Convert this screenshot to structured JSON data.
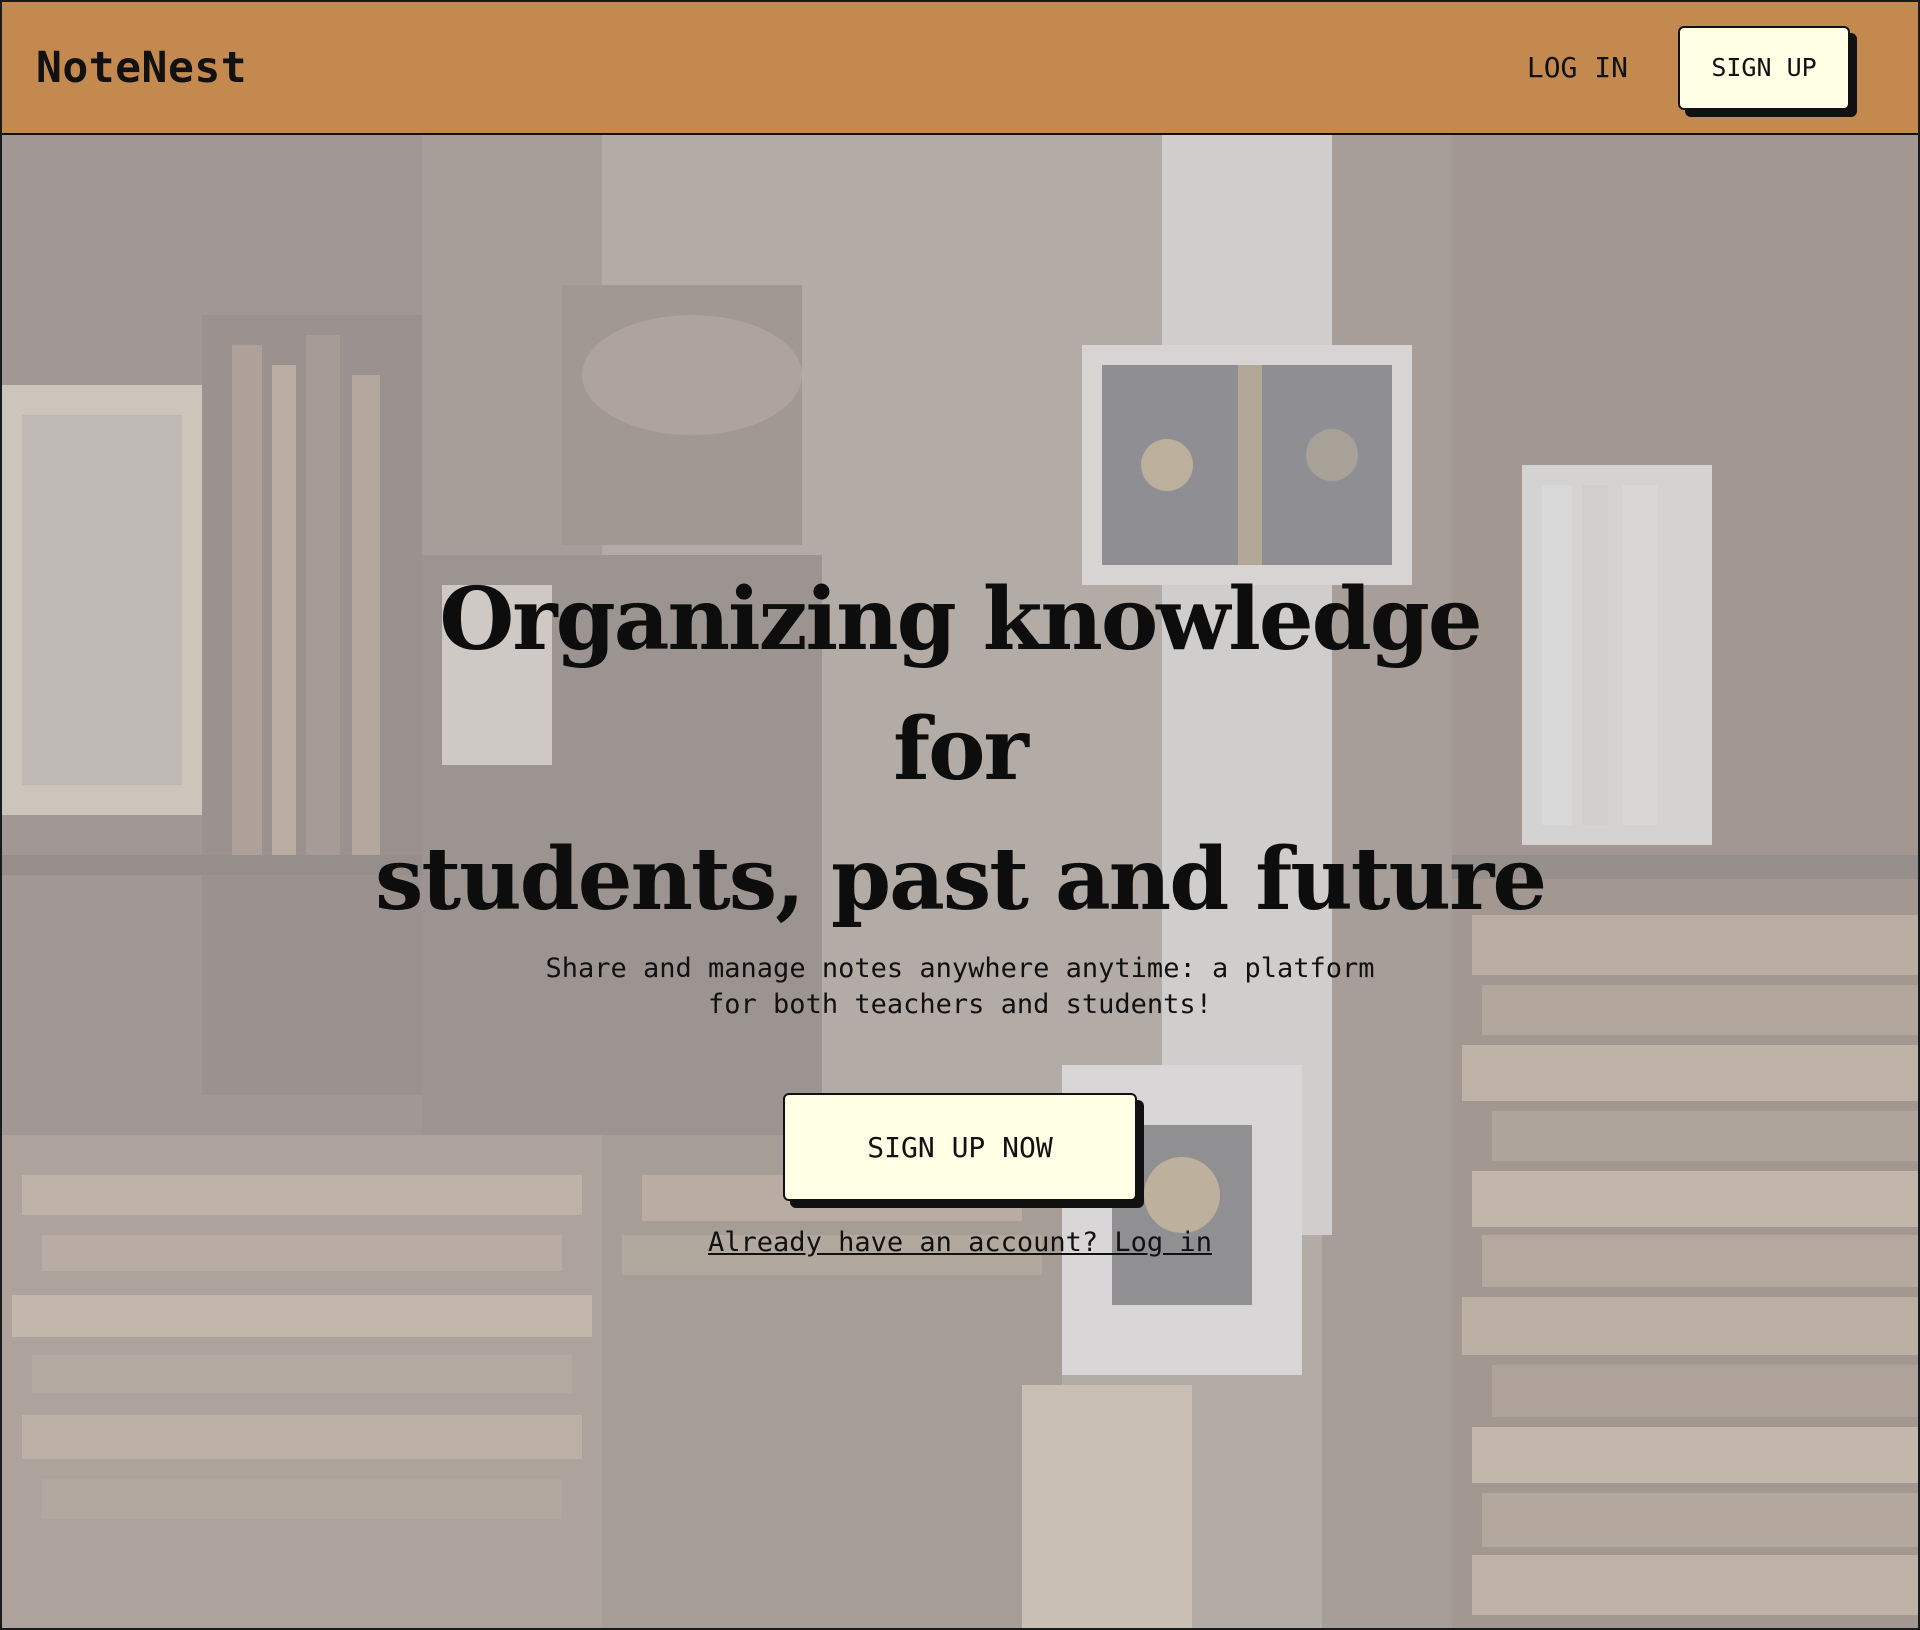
{
  "colors": {
    "navbar_bg": "#C4894E",
    "button_bg": "#FFFFE6",
    "text": "#111111"
  },
  "navbar": {
    "brand": "NoteNest",
    "login_label": "LOG IN",
    "signup_label": "SIGN UP"
  },
  "hero": {
    "background_image": "bookshop-shelves-photo",
    "title_line1": "Organizing knowledge for",
    "title_line2": "students, past and future",
    "subtitle_line1": "Share and manage notes anywhere anytime: a platform",
    "subtitle_line2": "for both teachers and students!",
    "cta_label": "SIGN UP NOW",
    "login_link": "Already have an account? Log in"
  }
}
